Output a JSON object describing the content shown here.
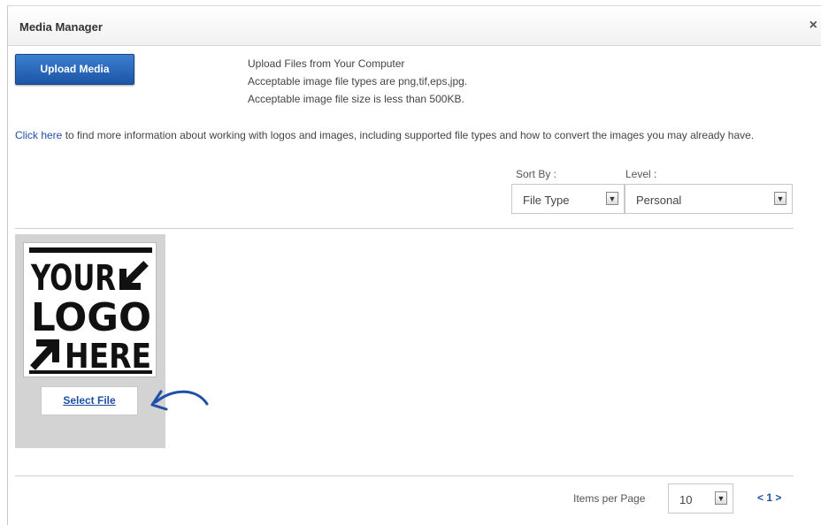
{
  "dialog": {
    "title": "Media Manager",
    "close_label": "×"
  },
  "upload": {
    "button_label": "Upload Media",
    "info": [
      "Upload Files from Your Computer",
      "Acceptable image file types are png,tif,eps,jpg.",
      "Acceptable image file size is less than 500KB."
    ]
  },
  "help": {
    "link_text": "Click here",
    "text": " to find more information about working with logos and images, including supported file types and how to convert the images you may already have."
  },
  "sort": {
    "label": "Sort By :",
    "value": "File Type"
  },
  "level": {
    "label": "Level :",
    "value": "Personal"
  },
  "media_items": [
    {
      "logo_lines": [
        "YOUR",
        "LOGO",
        "HERE"
      ],
      "select_label": "Select File"
    }
  ],
  "pagination": {
    "items_label": "Items per Page",
    "items_value": "10",
    "pager_text": "< 1 >"
  },
  "colors": {
    "accent": "#1f4fa8",
    "button": "#2a66b9",
    "tile_bg": "#d3d3d3",
    "annotation": "#1f4fa8"
  }
}
